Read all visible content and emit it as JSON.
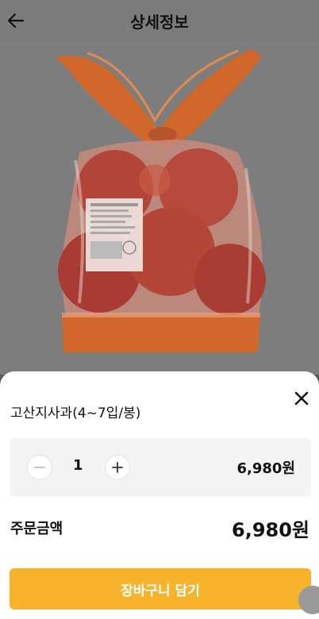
{
  "header": {
    "title": "상세정보",
    "back_icon": "arrow-left-icon"
  },
  "product_image": {
    "alt": "고산지사과 봉지 상품 이미지"
  },
  "sheet": {
    "product_name": "고산지사과(4~7입/봉)",
    "close_icon": "close-icon",
    "quantity": "1",
    "minus_icon": "minus-icon",
    "plus_icon": "plus-icon",
    "line_price": "6,980원",
    "total_label": "주문금액",
    "total_price": "6,980원",
    "cart_button_label": "장바구니 담기",
    "accent_color": "#f6b32b"
  }
}
